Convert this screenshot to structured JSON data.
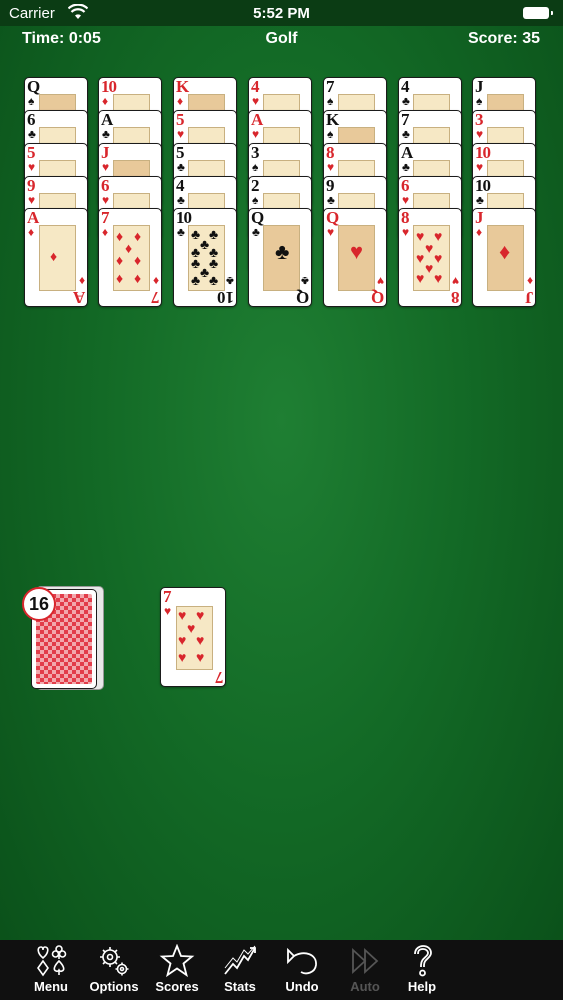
{
  "status": {
    "carrier": "Carrier",
    "time": "5:52 PM"
  },
  "header": {
    "time": "Time: 0:05",
    "title": "Golf",
    "score": "Score: 35"
  },
  "stock": {
    "count": "16"
  },
  "colors": {
    "felt": "#136a26",
    "red": "#d8262c",
    "toolbar": "#101010"
  },
  "columns": [
    [
      "Q♠",
      "6♣",
      "5♥",
      "9♥",
      "A♦"
    ],
    [
      "10♦",
      "A♣",
      "J♥",
      "6♥",
      "7♦"
    ],
    [
      "K♦",
      "5♥",
      "5♣",
      "4♣",
      "10♣"
    ],
    [
      "4♥",
      "A♥",
      "3♠",
      "2♠",
      "Q♣"
    ],
    [
      "7♠",
      "K♠",
      "8♥",
      "9♣",
      "Q♥"
    ],
    [
      "4♣",
      "7♣",
      "A♣",
      "6♥",
      "8♥"
    ],
    [
      "J♠",
      "3♥",
      "10♥",
      "10♣",
      "J♦"
    ]
  ],
  "cards": {
    "c0": {
      "rank": "Q",
      "suit": "♠"
    },
    "c1": {
      "rank": "6",
      "suit": "♣"
    },
    "c2": {
      "rank": "5",
      "suit": "♥"
    },
    "c3": {
      "rank": "9",
      "suit": "♥"
    },
    "c4": {
      "rank": "A",
      "suit": "♦"
    },
    "c5": {
      "rank": "10",
      "suit": "♦"
    },
    "c6": {
      "rank": "A",
      "suit": "♣"
    },
    "c7": {
      "rank": "J",
      "suit": "♥"
    },
    "c8": {
      "rank": "6",
      "suit": "♥"
    },
    "c9": {
      "rank": "7",
      "suit": "♦"
    },
    "c10": {
      "rank": "K",
      "suit": "♦"
    },
    "c11": {
      "rank": "5",
      "suit": "♥"
    },
    "c12": {
      "rank": "5",
      "suit": "♣"
    },
    "c13": {
      "rank": "4",
      "suit": "♣"
    },
    "c14": {
      "rank": "10",
      "suit": "♣"
    },
    "c15": {
      "rank": "4",
      "suit": "♥"
    },
    "c16": {
      "rank": "A",
      "suit": "♥"
    },
    "c17": {
      "rank": "3",
      "suit": "♠"
    },
    "c18": {
      "rank": "2",
      "suit": "♠"
    },
    "c19": {
      "rank": "Q",
      "suit": "♣"
    },
    "c20": {
      "rank": "7",
      "suit": "♠"
    },
    "c21": {
      "rank": "K",
      "suit": "♠"
    },
    "c22": {
      "rank": "8",
      "suit": "♥"
    },
    "c23": {
      "rank": "9",
      "suit": "♣"
    },
    "c24": {
      "rank": "Q",
      "suit": "♥"
    },
    "c25": {
      "rank": "4",
      "suit": "♣"
    },
    "c26": {
      "rank": "7",
      "suit": "♣"
    },
    "c27": {
      "rank": "A",
      "suit": "♣"
    },
    "c28": {
      "rank": "6",
      "suit": "♥"
    },
    "c29": {
      "rank": "8",
      "suit": "♥"
    },
    "c30": {
      "rank": "J",
      "suit": "♠"
    },
    "c31": {
      "rank": "3",
      "suit": "♥"
    },
    "c32": {
      "rank": "10",
      "suit": "♥"
    },
    "c33": {
      "rank": "10",
      "suit": "♣"
    },
    "c34": {
      "rank": "J",
      "suit": "♦"
    }
  },
  "waste": {
    "rank": "7",
    "suit": "♥"
  },
  "toolbar": [
    {
      "label": "Menu",
      "icon": "card-suits-icon",
      "enabled": true
    },
    {
      "label": "Options",
      "icon": "gears-icon",
      "enabled": true
    },
    {
      "label": "Scores",
      "icon": "star-icon",
      "enabled": true
    },
    {
      "label": "Stats",
      "icon": "chart-icon",
      "enabled": true
    },
    {
      "label": "Undo",
      "icon": "undo-icon",
      "enabled": true
    },
    {
      "label": "Auto",
      "icon": "fast-forward-icon",
      "enabled": false
    },
    {
      "label": "Help",
      "icon": "question-icon",
      "enabled": true
    }
  ]
}
